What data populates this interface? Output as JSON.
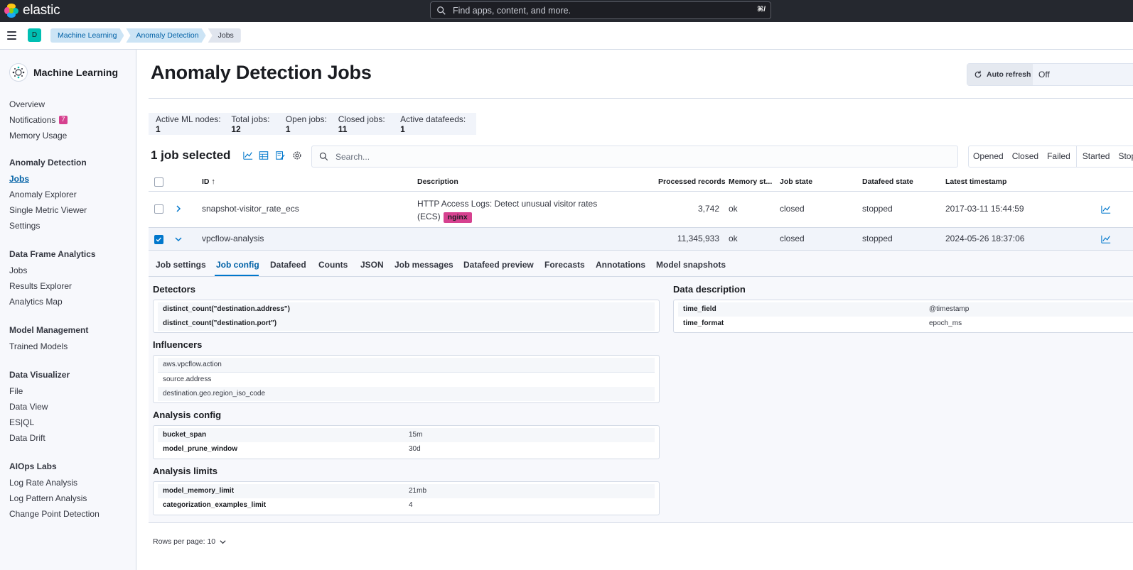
{
  "topbar": {
    "brand": "elastic",
    "search_placeholder": "Find apps, content, and more.",
    "search_shortcut": "⌘/"
  },
  "header": {
    "space_initial": "D",
    "breadcrumbs": [
      "Machine Learning",
      "Anomaly Detection",
      "Jobs"
    ]
  },
  "sidebar": {
    "title": "Machine Learning",
    "top_items": [
      {
        "label": "Overview"
      },
      {
        "label": "Notifications",
        "badge": "7"
      },
      {
        "label": "Memory Usage"
      }
    ],
    "sections": [
      {
        "heading": "Anomaly Detection",
        "items": [
          "Jobs",
          "Anomaly Explorer",
          "Single Metric Viewer",
          "Settings"
        ]
      },
      {
        "heading": "Data Frame Analytics",
        "items": [
          "Jobs",
          "Results Explorer",
          "Analytics Map"
        ]
      },
      {
        "heading": "Model Management",
        "items": [
          "Trained Models"
        ]
      },
      {
        "heading": "Data Visualizer",
        "items": [
          "File",
          "Data View",
          "ES|QL",
          "Data Drift"
        ]
      },
      {
        "heading": "AIOps Labs",
        "items": [
          "Log Rate Analysis",
          "Log Pattern Analysis",
          "Change Point Detection"
        ]
      }
    ]
  },
  "main": {
    "title": "Anomaly Detection Jobs",
    "auto_refresh_label": "Auto refresh",
    "auto_refresh_value": "Off",
    "stats": [
      {
        "label": "Active ML nodes:",
        "value": "1"
      },
      {
        "label": "Total jobs:",
        "value": "12"
      },
      {
        "label": "Open jobs:",
        "value": "1"
      },
      {
        "label": "Closed jobs:",
        "value": "11"
      },
      {
        "label": "Active datafeeds:",
        "value": "1"
      }
    ],
    "selected_label": "1 job selected",
    "search_placeholder": "Search...",
    "filters": [
      "Opened",
      "Closed",
      "Failed",
      "Started",
      "Stopped"
    ],
    "columns": {
      "id": "ID",
      "description": "Description",
      "processed": "Processed records",
      "memory": "Memory st...",
      "job_state": "Job state",
      "datafeed_state": "Datafeed state",
      "latest": "Latest timestamp"
    },
    "rows": [
      {
        "id": "snapshot-visitor_rate_ecs",
        "description_line1": "HTTP Access Logs: Detect unusual visitor rates",
        "description_line2": "(ECS)",
        "tag": "nginx",
        "processed": "3,742",
        "memory": "ok",
        "job_state": "closed",
        "datafeed_state": "stopped",
        "latest": "2017-03-11 15:44:59"
      },
      {
        "id": "vpcflow-analysis",
        "processed": "11,345,933",
        "memory": "ok",
        "job_state": "closed",
        "datafeed_state": "stopped",
        "latest": "2024-05-26 18:37:06"
      }
    ],
    "tabs": [
      "Job settings",
      "Job config",
      "Datafeed",
      "Counts",
      "JSON",
      "Job messages",
      "Datafeed preview",
      "Forecasts",
      "Annotations",
      "Model snapshots"
    ],
    "active_tab": "Job config",
    "job_config": {
      "detectors_title": "Detectors",
      "detectors": [
        "distinct_count(\"destination.address\")",
        "distinct_count(\"destination.port\")"
      ],
      "influencers_title": "Influencers",
      "influencers": [
        "aws.vpcflow.action",
        "source.address",
        "destination.geo.region_iso_code"
      ],
      "analysis_config_title": "Analysis config",
      "analysis_config": [
        {
          "k": "bucket_span",
          "v": "15m"
        },
        {
          "k": "model_prune_window",
          "v": "30d"
        }
      ],
      "analysis_limits_title": "Analysis limits",
      "analysis_limits": [
        {
          "k": "model_memory_limit",
          "v": "21mb"
        },
        {
          "k": "categorization_examples_limit",
          "v": "4"
        }
      ],
      "data_description_title": "Data description",
      "data_description": [
        {
          "k": "time_field",
          "v": "@timestamp"
        },
        {
          "k": "time_format",
          "v": "epoch_ms"
        }
      ]
    },
    "rows_per_page": "Rows per page: 10"
  },
  "colors": {
    "accent": "#0077cc",
    "link": "#0061a6",
    "badge": "#d6418f",
    "topbar": "#25282f"
  }
}
